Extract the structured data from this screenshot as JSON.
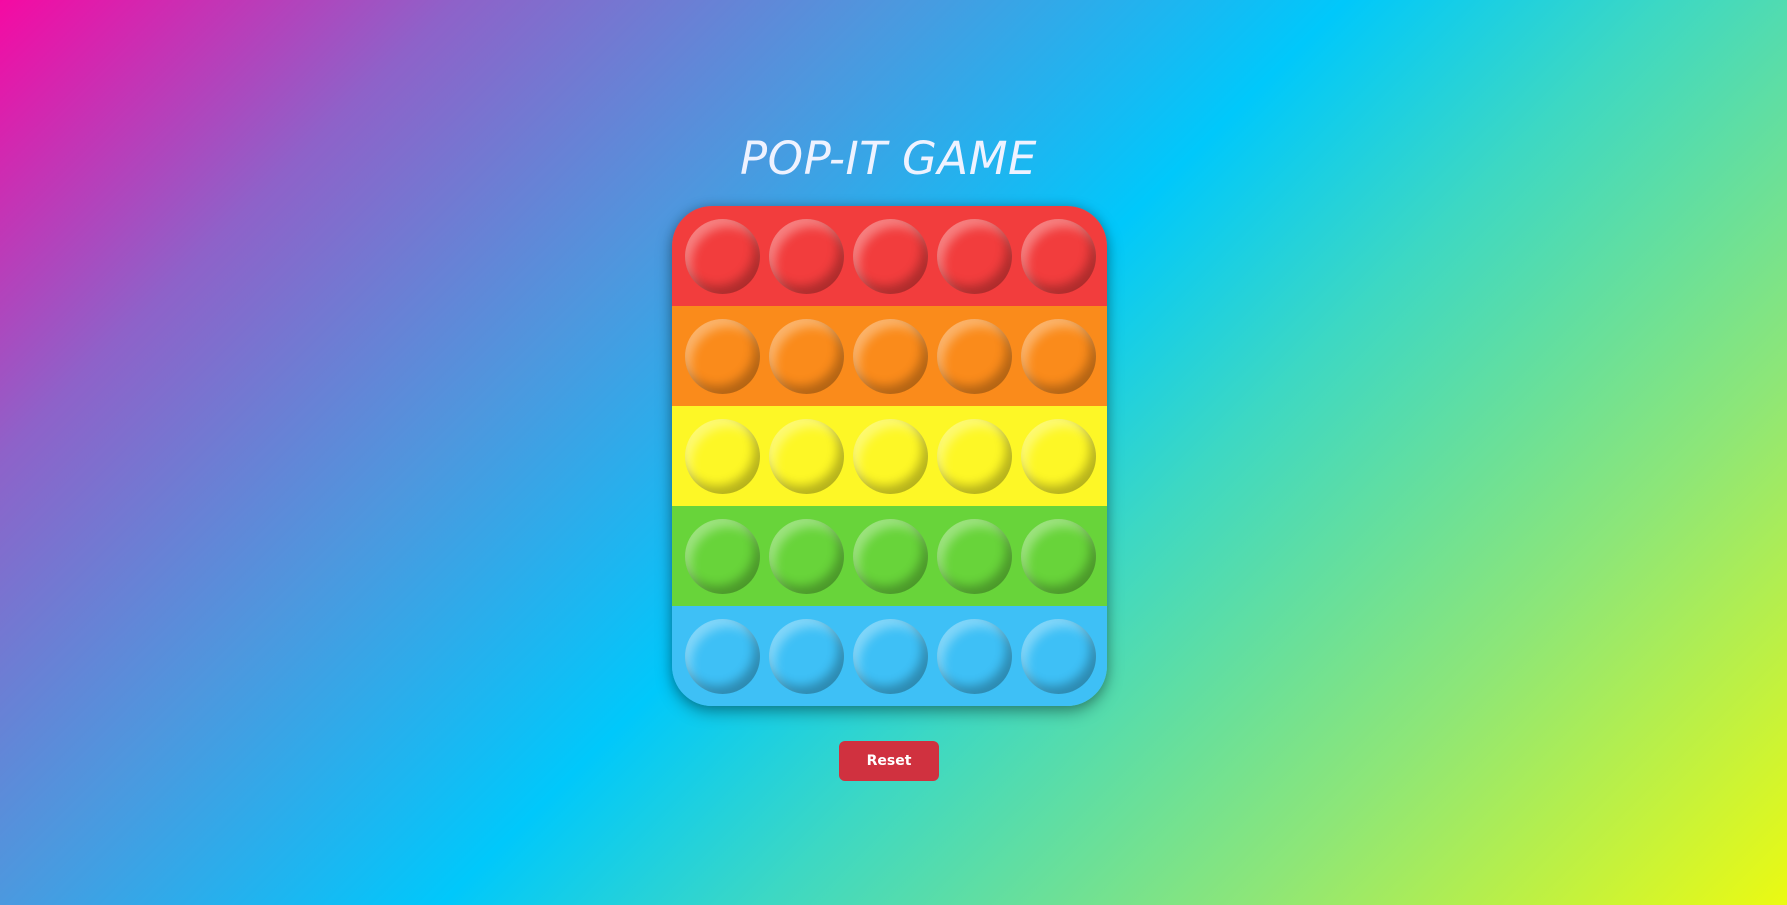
{
  "title": "POP-IT GAME",
  "reset_label": "Reset",
  "colors": {
    "background_gradient": [
      "#f50aa3",
      "#00c8fb",
      "#ebfa12"
    ],
    "button": "#d0313f"
  },
  "board": {
    "rows": [
      {
        "color": "#f23d3d",
        "bubbles": 5
      },
      {
        "color": "#fa8b1b",
        "bubbles": 5
      },
      {
        "color": "#fdf726",
        "bubbles": 5
      },
      {
        "color": "#68d43a",
        "bubbles": 5
      },
      {
        "color": "#3ec0f6",
        "bubbles": 5
      }
    ]
  }
}
